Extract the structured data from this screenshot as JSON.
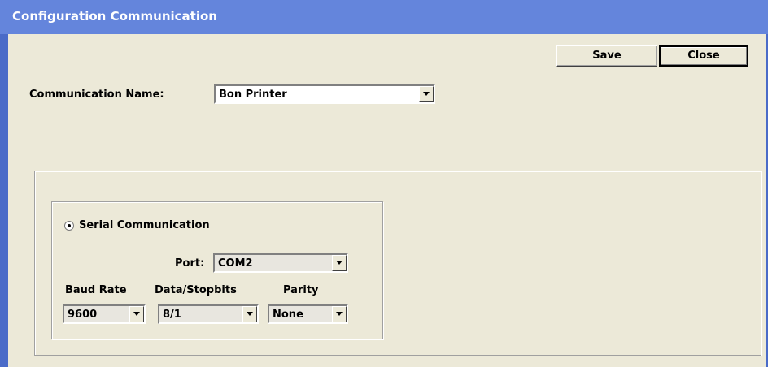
{
  "window": {
    "title": "Configuration Communication"
  },
  "toolbar": {
    "save_label": "Save",
    "close_label": "Close"
  },
  "communication": {
    "label": "Communication Name:",
    "value": "Bon Printer"
  },
  "serial": {
    "radio_label": "Serial Communication",
    "selected": true,
    "port": {
      "label": "Port:",
      "value": "COM2"
    },
    "baud": {
      "label": "Baud Rate",
      "value": "9600"
    },
    "datastop": {
      "label": "Data/Stopbits",
      "value": "8/1"
    },
    "parity": {
      "label": "Parity",
      "value": "None"
    }
  },
  "icons": {
    "dropdown": "chevron-down-icon",
    "radio": "radio-selected-icon"
  }
}
